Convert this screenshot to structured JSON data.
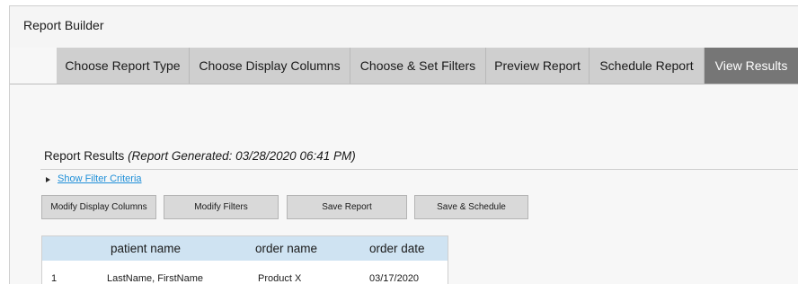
{
  "app": {
    "title": "Report Builder"
  },
  "tabs": [
    {
      "label": "Choose Report Type",
      "active": false
    },
    {
      "label": "Choose Display Columns",
      "active": false
    },
    {
      "label": "Choose & Set Filters",
      "active": false
    },
    {
      "label": "Preview Report",
      "active": false
    },
    {
      "label": "Schedule Report",
      "active": false
    },
    {
      "label": "View Results",
      "active": true
    }
  ],
  "results": {
    "heading": "Report Results",
    "generated": "(Report Generated: 03/28/2020 06:41 PM)",
    "filter_toggle_icon": "triangle-right-icon",
    "filter_link": "Show Filter Criteria"
  },
  "actions": {
    "modify_columns": "Modify Display Columns",
    "modify_filters": "Modify Filters",
    "save_report": "Save Report",
    "save_schedule": "Save & Schedule"
  },
  "table": {
    "columns": [
      "",
      "patient name",
      "order name",
      "order date"
    ],
    "rows": [
      [
        "1",
        "LastName, FirstName",
        "Product X",
        "03/17/2020"
      ]
    ]
  },
  "colors": {
    "active_tab": "#767676",
    "inactive_tab": "#cfcfcf",
    "link": "#1f8fd8",
    "table_header": "#cfe3f2"
  }
}
